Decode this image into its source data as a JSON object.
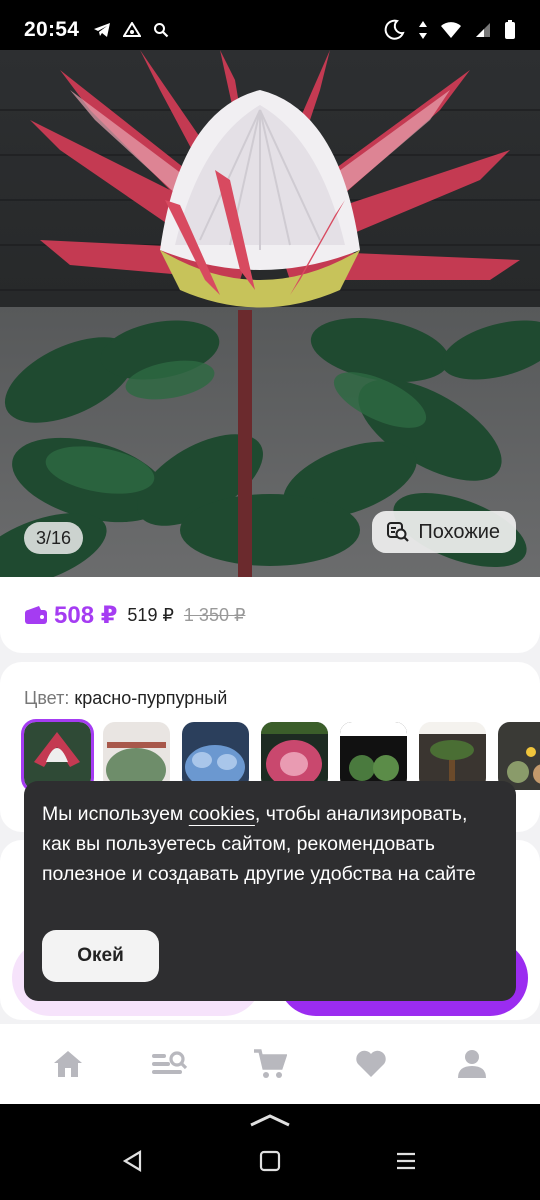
{
  "status_bar": {
    "time": "20:54"
  },
  "gallery": {
    "counter": "3/16",
    "similar_label": "Похожие"
  },
  "price": {
    "current": "508 ₽",
    "regular": "519 ₽",
    "old": "1 350 ₽"
  },
  "color": {
    "label": "Цвет:",
    "value": "красно-пурпурный"
  },
  "cookie_banner": {
    "text_before": "Мы используем ",
    "link": "cookies",
    "text_after": ", чтобы анализировать, как вы пользуетесь сайтом, рекомендовать полезное и создавать другие удобства на сайте",
    "ok_label": "Окей"
  },
  "nav_icons": [
    "home-icon",
    "catalog-search-icon",
    "cart-icon",
    "favorites-heart-icon",
    "profile-icon"
  ],
  "colors": {
    "accent": "#a53cf2",
    "dark_banner": "#2e2e30"
  }
}
